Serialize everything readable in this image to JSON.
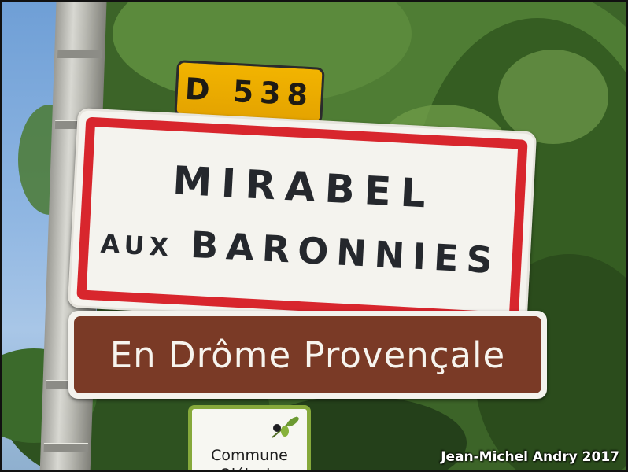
{
  "photo": {
    "road_number": "D 538",
    "town_sign": {
      "line1": "MIRABEL",
      "line2_prefix": "AUX",
      "line2_main": "BARONNIES"
    },
    "region_sign": {
      "text": "En Drôme Provençale"
    },
    "olive_sign": {
      "line1": "Commune",
      "line2": "Oléicole",
      "icon": "olive-branch-icon"
    },
    "credit": "Jean-Michel Andry 2017"
  },
  "colors": {
    "road_plate": "#f2b400",
    "town_border": "#d8262d",
    "region_sign": "#7a3a26",
    "olive_border": "#86a93b",
    "sky": "#7fa9dc",
    "foliage": "#3f6b2a"
  }
}
